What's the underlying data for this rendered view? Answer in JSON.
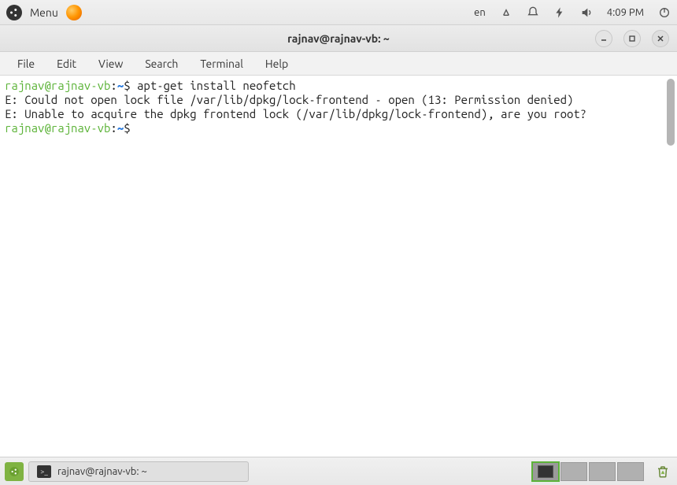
{
  "top_panel": {
    "menu_label": "Menu",
    "lang": "en",
    "time": "4:09 PM"
  },
  "window": {
    "title": "rajnav@rajnav-vb: ~"
  },
  "menubar": {
    "file": "File",
    "edit": "Edit",
    "view": "View",
    "search": "Search",
    "terminal": "Terminal",
    "help": "Help"
  },
  "terminal": {
    "prompt_user": "rajnav@rajnav-vb",
    "prompt_sep": ":",
    "prompt_path": "~",
    "prompt_sym": "$",
    "line1_cmd": " apt-get install neofetch",
    "line2": "E: Could not open lock file /var/lib/dpkg/lock-frontend - open (13: Permission denied)",
    "line3": "E: Unable to acquire the dpkg frontend lock (/var/lib/dpkg/lock-frontend), are you root?",
    "line4_cmd": " "
  },
  "taskbar": {
    "title": "rajnav@rajnav-vb: ~"
  }
}
